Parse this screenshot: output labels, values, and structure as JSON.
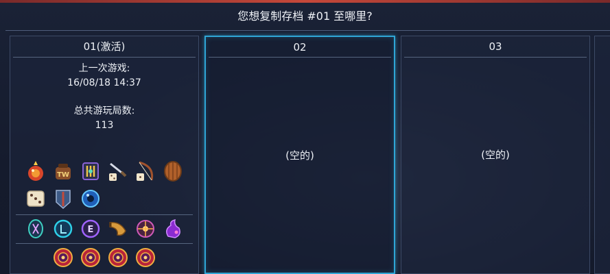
{
  "header": {
    "prompt": "您想复制存档 #01 至哪里?"
  },
  "slots": [
    {
      "title": "01(激活)",
      "last_played_label": "上一次游戏:",
      "last_played_value": "16/08/18 14:37",
      "total_runs_label": "总共游玩局数:",
      "total_runs_value": "113"
    },
    {
      "title": "02",
      "empty_text": "(空的)"
    },
    {
      "title": "03",
      "empty_text": "(空的)"
    }
  ],
  "items": {
    "row1": [
      "fire-bomb-icon",
      "tw-bag-icon",
      "rune-scroll-icon",
      "sword-dice-icon",
      "bow-dice-icon",
      "wooden-shield-icon"
    ],
    "row2": [
      "dice-icon",
      "heavy-armor-icon",
      "blue-orb-icon"
    ],
    "row3": [
      "teal-rune-icon",
      "blue-cell-icon",
      "purple-e-rune-icon",
      "horn-icon",
      "spark-rune-icon",
      "purple-flame-icon"
    ],
    "row4": [
      "red-medallion-icon",
      "red-medallion-icon",
      "red-medallion-icon",
      "red-medallion-icon"
    ]
  },
  "colors": {
    "accent": "#2fa6d6",
    "top_strip": "#c5483a",
    "background": "#141a2c"
  }
}
